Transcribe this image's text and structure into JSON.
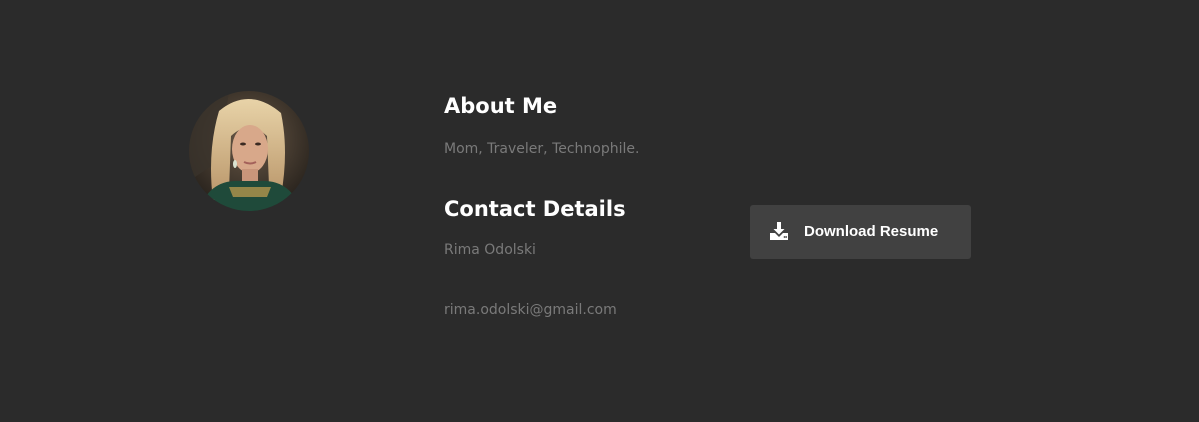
{
  "about": {
    "title": "About Me",
    "bio": "Mom, Traveler, Technophile."
  },
  "contact": {
    "title": "Contact Details",
    "name": "Rima Odolski",
    "email": "rima.odolski@gmail.com"
  },
  "resume_button": {
    "label": "Download Resume",
    "icon": "download-icon"
  },
  "colors": {
    "background": "#2b2b2b",
    "heading": "#ffffff",
    "muted_text": "#7a7a7a",
    "button_bg": "#414141"
  }
}
